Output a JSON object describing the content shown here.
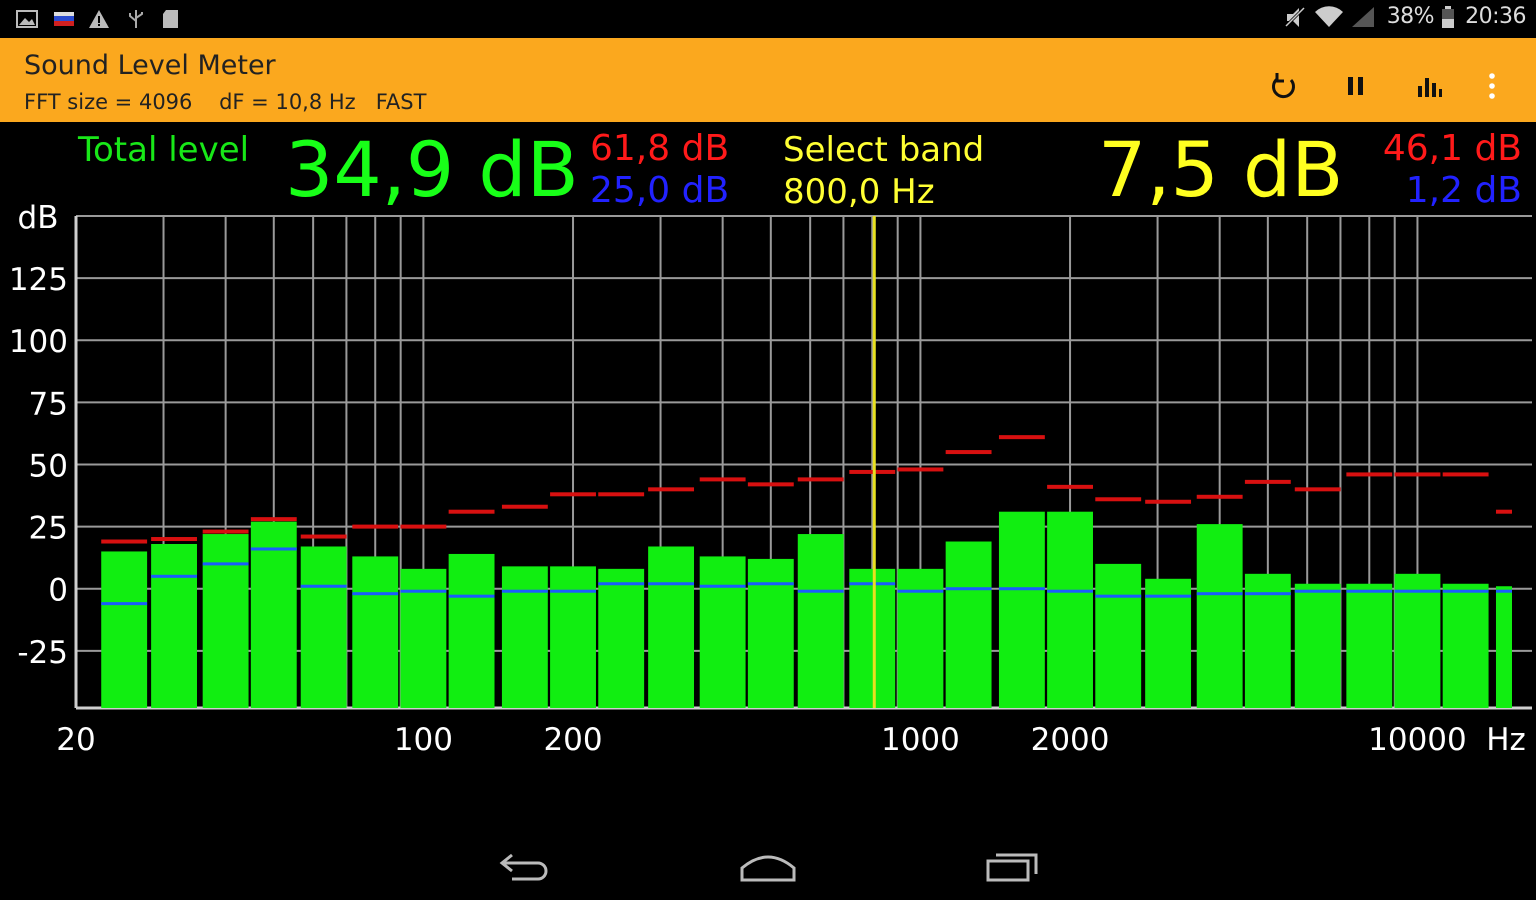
{
  "status_bar": {
    "left_icons": [
      "image-icon",
      "flag-icon",
      "warning-icon",
      "usb-icon",
      "sd-card-icon"
    ],
    "battery": "38%",
    "time": "20:36",
    "right_icons": [
      "mute-icon",
      "wifi-icon",
      "signal-icon",
      "battery-icon"
    ]
  },
  "action_bar": {
    "title": "Sound Level Meter",
    "subtitle": "FFT size = 4096    dF = 10,8 Hz   FAST",
    "actions": [
      "reset-icon",
      "pause-icon",
      "bar-chart-icon",
      "overflow-menu-icon"
    ]
  },
  "readouts": {
    "total_label": "Total level",
    "total_value": "34,9 dB",
    "total_max": "61,8 dB",
    "total_min": "25,0 dB",
    "band_label": "Select band",
    "band_freq": "800,0 Hz",
    "band_value": "7,5 dB",
    "band_max": "46,1 dB",
    "band_min": "1,2 dB"
  },
  "colors": {
    "action_bar": "#fba81e",
    "bar": "#11ee11",
    "max_marker": "#d81010",
    "min_marker": "#1a5cff",
    "selector": "#e8e020",
    "grid": "#9a9a9a"
  },
  "chart_data": {
    "type": "bar",
    "ylabel": "dB",
    "xlabel": "Hz",
    "y_ticks": [
      "125",
      "100",
      "75",
      "50",
      "25",
      "0",
      "-25"
    ],
    "ylim": [
      -48,
      150
    ],
    "xlim": [
      20,
      17000
    ],
    "x_scale": "log",
    "x_ticks": [
      "20",
      "100",
      "200",
      "1000",
      "2000",
      "10000"
    ],
    "grid": true,
    "selected_band_hz": 800,
    "bands": [
      25,
      31.5,
      40,
      50,
      63,
      80,
      100,
      125,
      160,
      200,
      250,
      315,
      400,
      500,
      630,
      800,
      1000,
      1250,
      1600,
      2000,
      2500,
      3150,
      4000,
      5000,
      6300,
      8000,
      10000,
      12500,
      16000
    ],
    "values": [
      15,
      18,
      22,
      27,
      17,
      13,
      8,
      14,
      9,
      9,
      8,
      17,
      13,
      12,
      22,
      8,
      8,
      19,
      31,
      31,
      10,
      4,
      26,
      6,
      2,
      2,
      6,
      2,
      1
    ],
    "max_values": [
      19,
      20,
      23,
      28,
      21,
      25,
      25,
      31,
      33,
      38,
      38,
      40,
      44,
      42,
      44,
      47,
      48,
      55,
      61,
      41,
      36,
      35,
      37,
      43,
      40,
      46,
      46,
      46,
      31
    ],
    "min_values": [
      -6,
      5,
      10,
      16,
      1,
      -2,
      -1,
      -3,
      -1,
      -1,
      2,
      2,
      1,
      2,
      -1,
      2,
      -1,
      0,
      0,
      -1,
      -3,
      -3,
      -2,
      -2,
      -1,
      -1,
      -1,
      -1,
      -1
    ]
  }
}
